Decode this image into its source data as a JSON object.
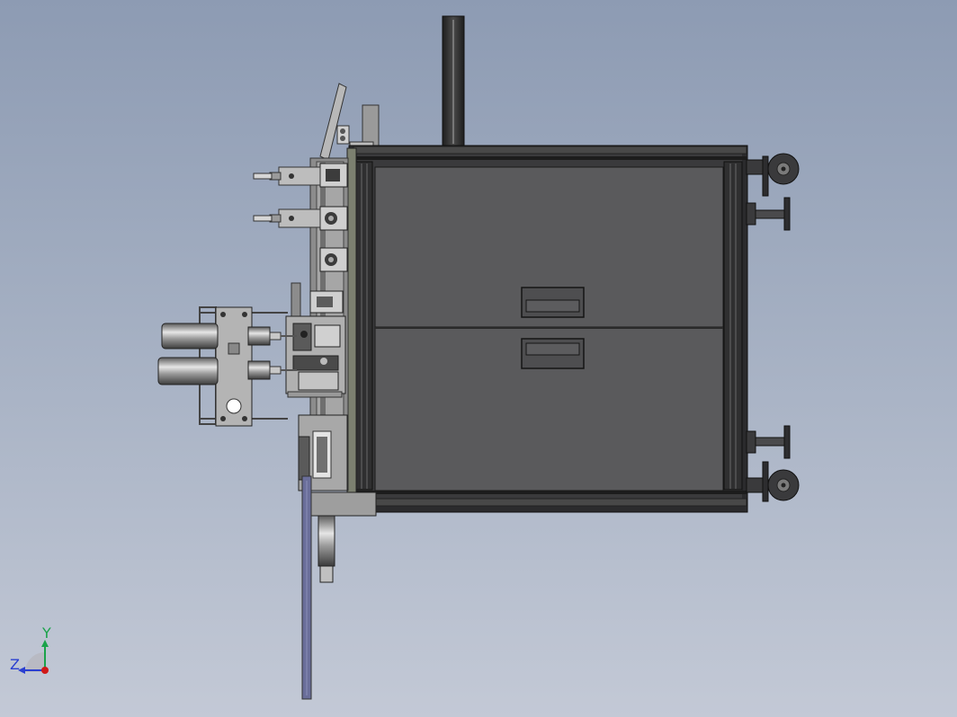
{
  "triad": {
    "y_label": "Y",
    "z_label": "Z",
    "colors": {
      "y_axis": "#1aa34a",
      "z_axis": "#2a3fd1",
      "x_axis": "#d01818"
    }
  },
  "colors": {
    "background_top": "#8d9bb3",
    "background_bottom": "#c3c9d6",
    "cabinet_body": "#5a5a5c",
    "frame_dark": "#2b2b2d",
    "frame_mid": "#7a7a7a",
    "metal_light": "#cfcfcf",
    "wheel": "#3a3a3c",
    "rail_blue": "#6a6e9a"
  }
}
